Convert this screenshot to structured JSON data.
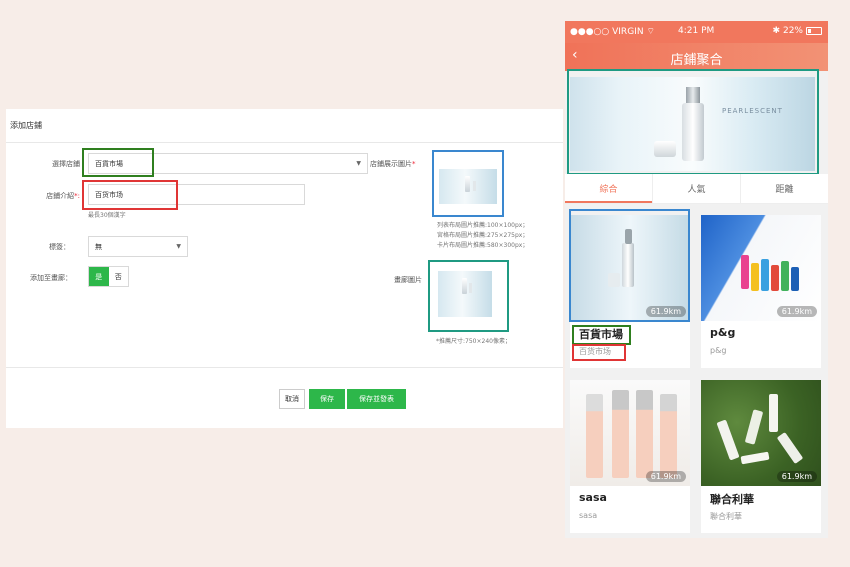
{
  "form": {
    "title": "添加店鋪",
    "store_label": "選擇店鋪",
    "store_value": "百貨市場",
    "intro_label": "店鋪介紹",
    "intro_required": "*:",
    "intro_value": "百货市场",
    "intro_hint": "最長30個漢字",
    "display_image_label": "店鋪展示圖片",
    "display_image_required": "*",
    "display_image_hints": [
      "列表布局圖片推薦:100×100px；",
      "宮格布局圖片推薦:275×275px；",
      "卡片布局圖片推薦:580×300px；"
    ],
    "tag_label": "標簽：",
    "tag_value": "無",
    "add_to_album_label": "添加至畫廊：",
    "toggle_yes": "是",
    "toggle_no": "否",
    "album_image_label": "畫廊圖片",
    "album_image_hint": "*推薦尺寸:750×240像素；",
    "cancel_button": "取消",
    "save_button": "保存",
    "save_publish_button": "保存並發表"
  },
  "phone": {
    "status": {
      "carrier": "●●●○○ VIRGIN",
      "wifi": "wifi-icon",
      "time": "4:21 PM",
      "bluetooth": "✱",
      "battery_text": "22%",
      "battery_level": 0.22
    },
    "nav": {
      "back": "‹",
      "title": "店鋪聚合"
    },
    "banner_text": "PEARLESCENT",
    "tabs": [
      "綜合",
      "人氣",
      "距離"
    ],
    "active_tab": 0,
    "cards": [
      {
        "name": "百貨市場",
        "sub": "百货市场",
        "distance": "61.9km"
      },
      {
        "name": "p&g",
        "sub": "p&g",
        "distance": "61.9km"
      },
      {
        "name": "sasa",
        "sub": "sasa",
        "distance": "61.9km"
      },
      {
        "name": "聯合利華",
        "sub": "聯合利華",
        "distance": "61.9km"
      }
    ]
  },
  "colors": {
    "accent": "#f1775d",
    "primary_button": "#2db74a",
    "highlight_green": "#2f7f1f",
    "highlight_red": "#e03535",
    "highlight_blue": "#3a87cf",
    "highlight_teal": "#1f9a82"
  }
}
